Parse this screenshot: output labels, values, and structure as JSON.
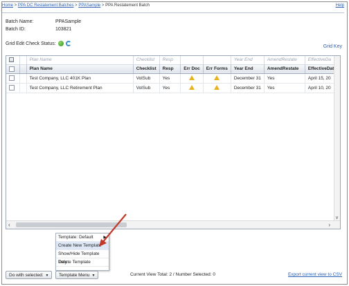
{
  "breadcrumb": {
    "home": "Home",
    "batches": "PPA DC Restatement Batches",
    "sample": "PPASample",
    "current": "PPA Restatement Batch",
    "separator": ">",
    "help": "Help"
  },
  "batch": {
    "name_label": "Batch Name:",
    "name_value": "PPASample",
    "id_label": "Batch ID:",
    "id_value": "103821"
  },
  "grid_status_label": "Grid Edit Check Status:",
  "grid_key": "Grid Key",
  "table": {
    "filter_placeholders": [
      "Plan Name",
      "Checklist",
      "Resp",
      "",
      "",
      "Year End",
      "AmendRestate",
      "EffectiveDa"
    ],
    "columns": [
      "Plan Name",
      "Checklist",
      "Resp",
      "Err Doc",
      "Err Forms",
      "Year End",
      "AmendRestate",
      "EffectiveDate"
    ],
    "rows": [
      {
        "plan": "Test Company, LLC 401K Plan",
        "checklist": "VolSub",
        "resp": "Yes",
        "year_end": "December 31",
        "amend": "Yes",
        "effective": "April 15, 20"
      },
      {
        "plan": "Test Company, LLC Retirement Plan",
        "checklist": "VolSub",
        "resp": "Yes",
        "year_end": "December 31",
        "amend": "Yes",
        "effective": "April 10, 20"
      }
    ]
  },
  "menu": {
    "template_default": "Template: Default",
    "create": "Create New Template",
    "show_hide": "Show/Hide Template Tray",
    "delete": "Delete Template"
  },
  "footer": {
    "do_with_selected": "Do with selected:",
    "template_menu": "Template Menu",
    "view_total": "Current View Total: 2 / Number Selected: 0",
    "export": "Export current view to CSV"
  },
  "colors": {
    "link": "#2a5db0",
    "warning": "#e8b31a",
    "arrow": "#c0392b"
  }
}
